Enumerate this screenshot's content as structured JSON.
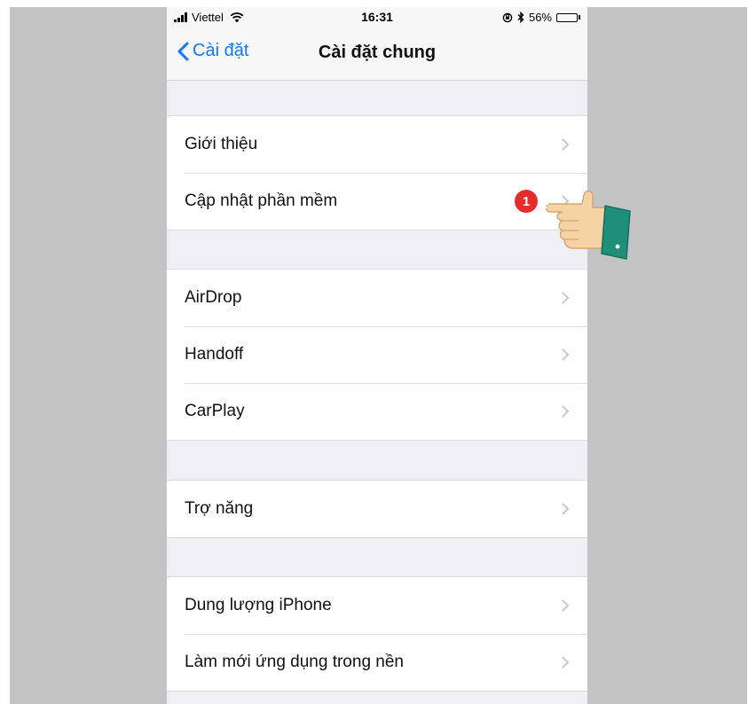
{
  "statusbar": {
    "carrier": "Viettel",
    "time": "16:31",
    "battery": "56%",
    "battery_level": 56,
    "icons": [
      "signal-icon",
      "wifi-icon",
      "rotation-lock-icon",
      "bluetooth-icon",
      "battery-icon"
    ]
  },
  "navbar": {
    "back_label": "Cài đặt",
    "title": "Cài đặt chung"
  },
  "groups": [
    {
      "items": [
        {
          "label": "Giới thiệu"
        },
        {
          "label": "Cập nhật phần mềm",
          "badge": "1"
        }
      ]
    },
    {
      "items": [
        {
          "label": "AirDrop"
        },
        {
          "label": "Handoff"
        },
        {
          "label": "CarPlay"
        }
      ]
    },
    {
      "items": [
        {
          "label": "Trợ năng"
        }
      ]
    },
    {
      "items": [
        {
          "label": "Dung lượng iPhone"
        },
        {
          "label": "Làm mới ứng dụng trong nền"
        }
      ]
    }
  ],
  "colors": {
    "accent": "#1677f3",
    "badge": "#e52b2b",
    "background": "#efeff4",
    "backdrop": "#c4c3c4"
  }
}
